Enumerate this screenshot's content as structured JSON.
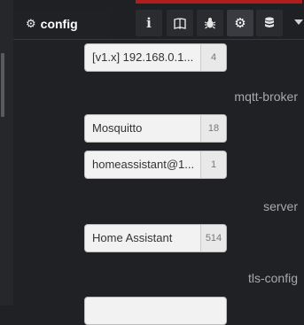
{
  "header": {
    "tab_label": "config",
    "tab_icon": "gear-icon",
    "tools": [
      {
        "name": "info",
        "icon": "info-icon"
      },
      {
        "name": "help",
        "icon": "book-icon"
      },
      {
        "name": "debug",
        "icon": "bug-icon"
      },
      {
        "name": "config",
        "icon": "gear-icon",
        "active": true
      },
      {
        "name": "context",
        "icon": "database-icon"
      }
    ]
  },
  "config_nodes": {
    "top": {
      "label": "[v1.x] 192.168.0.1...",
      "count": "4"
    },
    "mqtt_broker": {
      "title": "mqtt-broker",
      "items": [
        {
          "label": "Mosquitto",
          "count": "18"
        },
        {
          "label": "homeassistant@1...",
          "count": "1"
        }
      ]
    },
    "server": {
      "title": "server",
      "items": [
        {
          "label": "Home Assistant",
          "count": "514"
        }
      ]
    },
    "tls_config": {
      "title": "tls-config"
    }
  },
  "colors": {
    "background": "#202124",
    "accent": "#b11c1c",
    "node_bg": "#f2f2f2"
  }
}
